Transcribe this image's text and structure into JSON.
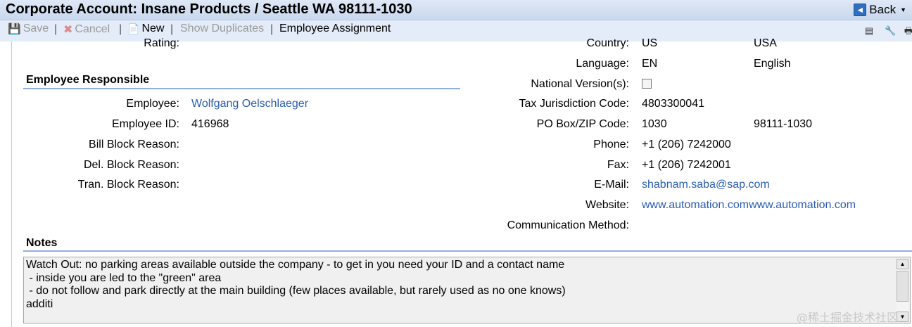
{
  "header": {
    "title": "Corporate Account: Insane Products / Seattle WA 98111-1030",
    "back_label": "Back"
  },
  "toolbar": {
    "save_label": "Save",
    "cancel_label": "Cancel",
    "new_label": "New",
    "show_duplicates_label": "Show Duplicates",
    "employee_assignment_label": "Employee Assignment"
  },
  "left": {
    "rating_label": "Rating:",
    "section_title": "Employee Responsible",
    "fields": [
      {
        "label": "Employee:",
        "value": "Wolfgang Oelschlaeger"
      },
      {
        "label": "Employee ID:",
        "value": "416968"
      },
      {
        "label": "Bill Block Reason:",
        "value": ""
      },
      {
        "label": "Del. Block Reason:",
        "value": ""
      },
      {
        "label": "Tran. Block Reason:",
        "value": ""
      }
    ]
  },
  "right": {
    "country_label": "Country:",
    "country_code": "US",
    "country_name": "USA",
    "language_label": "Language:",
    "language_code": "EN",
    "language_name": "English",
    "national_version_label": "National Version(s):",
    "national_version_checked": false,
    "tax_label": "Tax Jurisdiction Code:",
    "tax_value": "4803300041",
    "pobox_label": "PO Box/ZIP Code:",
    "pobox_value": "1030",
    "zip_value": "98111-1030",
    "phone_label": "Phone:",
    "phone_value": "+1 (206) 7242000",
    "fax_label": "Fax:",
    "fax_value": "+1 (206) 7242001",
    "email_label": "E-Mail:",
    "email_value": "shabnam.saba@sap.com",
    "website_label": "Website:",
    "website_value": "www.automation.comwww.automation.com",
    "comm_label": "Communication Method:",
    "comm_value": ""
  },
  "notes": {
    "section_title": "Notes",
    "text": "Watch Out: no parking areas available outside the company - to get in you need your ID and a contact name\n - inside you are led to the \"green\" area\n - do not follow and park directly at the main building (few places available, but rarely used as no one knows)\nadditi"
  },
  "watermark": "@稀土掘金技术社区",
  "colors": {
    "link": "#2a5db0",
    "header_bg": "#c9d8ee",
    "section_line": "#8fb0dc"
  }
}
